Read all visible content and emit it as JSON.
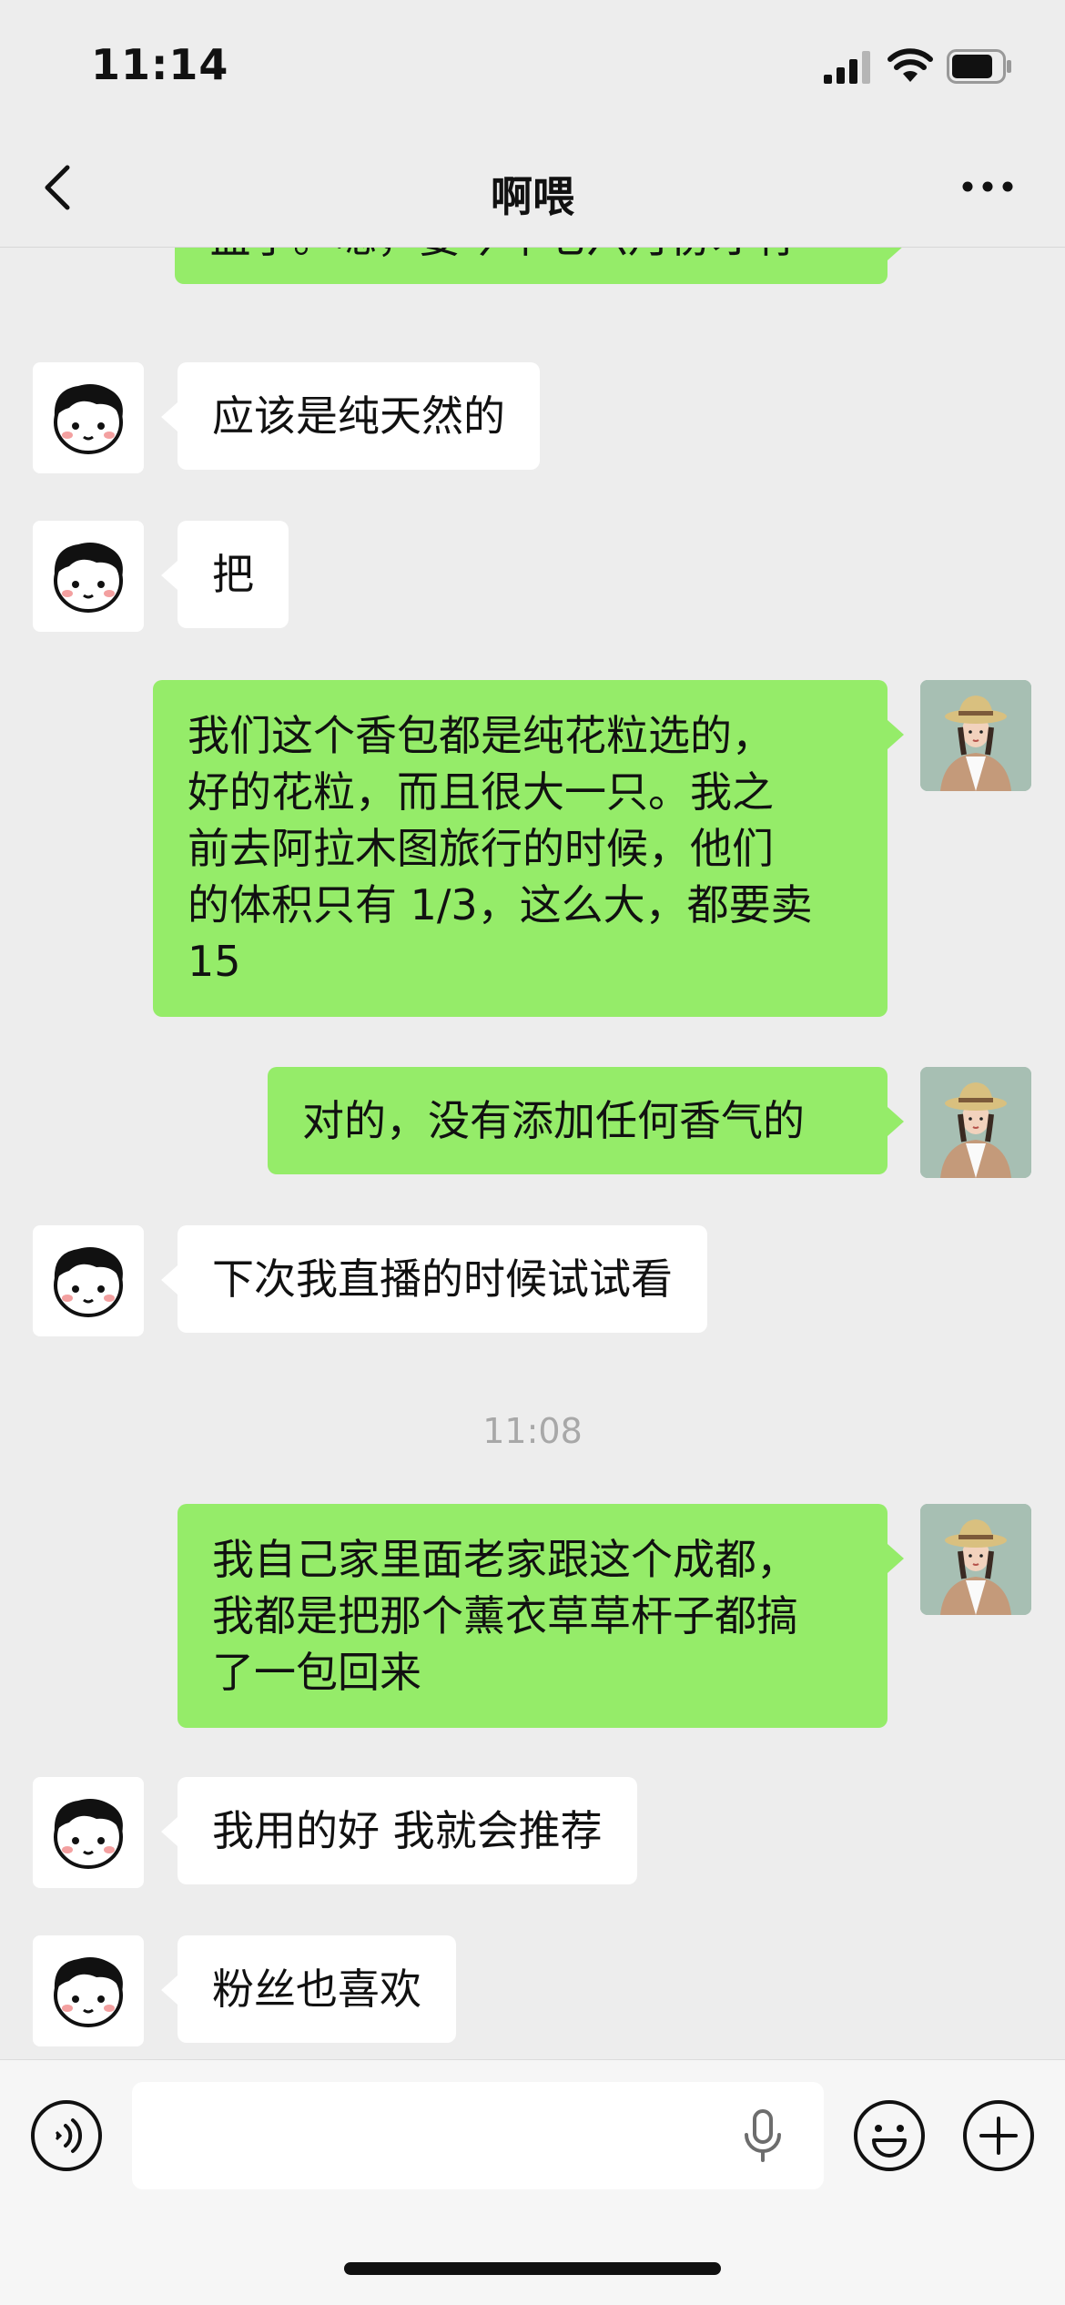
{
  "status_bar": {
    "time": "11:14"
  },
  "nav": {
    "title": "啊喂"
  },
  "messages": [
    {
      "sender": "me",
      "text": "盒了。嗯，要今年七六月份才有"
    },
    {
      "sender": "peer",
      "text": "应该是纯天然的"
    },
    {
      "sender": "peer",
      "text": "把"
    },
    {
      "sender": "me",
      "text": "我们这个香包都是纯花粒选的，\n好的花粒，而且很大一只。我之\n前去阿拉木图旅行的时候，他们\n的体积只有 1/3，这么大，都要卖\n15"
    },
    {
      "sender": "me",
      "text": "对的，没有添加任何香气的"
    },
    {
      "sender": "peer",
      "text": "下次我直播的时候试试看"
    },
    {
      "type": "time",
      "text": "11:08"
    },
    {
      "sender": "me",
      "text": "我自己家里面老家跟这个成都，\n我都是把那个薰衣草草杆子都搞\n了一包回来"
    },
    {
      "sender": "peer",
      "text": "我用的好 我就会推荐"
    },
    {
      "sender": "peer",
      "text": "粉丝也喜欢"
    }
  ],
  "input": {
    "placeholder": ""
  },
  "icons": {
    "back": "chevron-left-icon",
    "more": "more-dots-icon",
    "voice": "voice-icon",
    "mic": "mic-icon",
    "emoji": "emoji-icon",
    "plus": "plus-icon"
  },
  "colors": {
    "background": "#ededed",
    "my_bubble": "#95ec69",
    "peer_bubble": "#ffffff",
    "timestamp": "#a8a8a8"
  }
}
